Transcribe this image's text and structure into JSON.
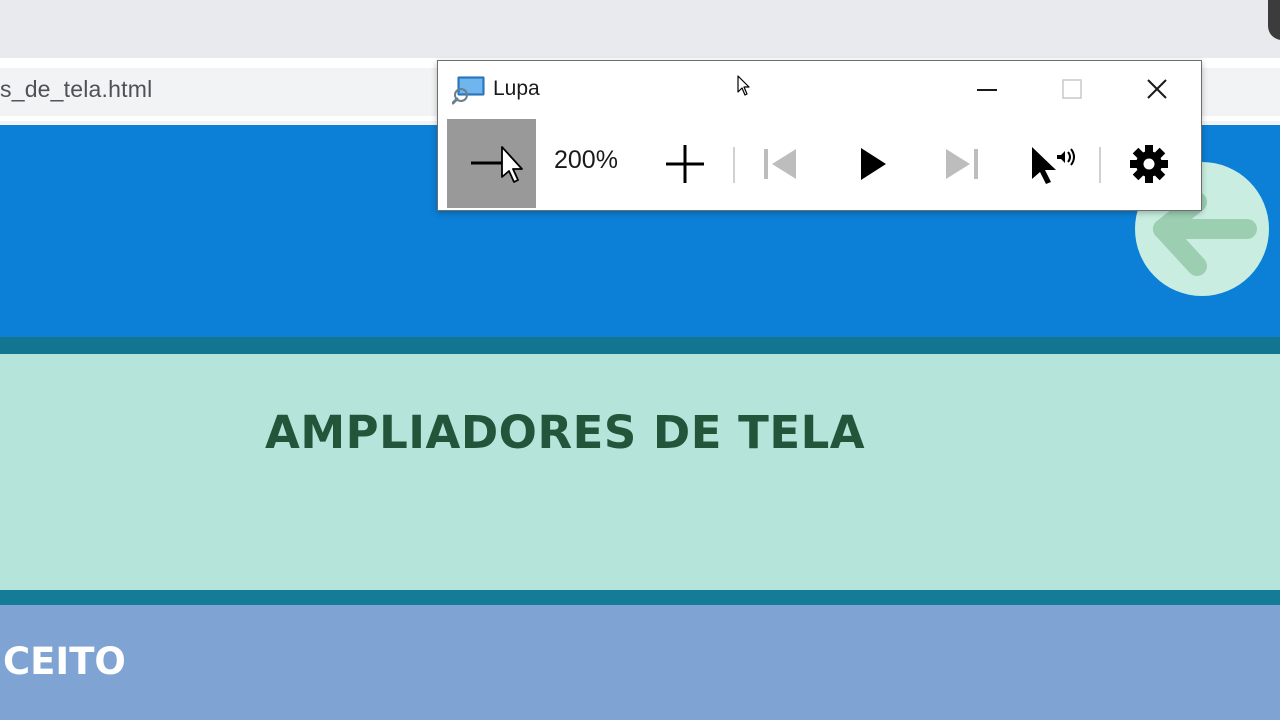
{
  "browser": {
    "url_text": "s_de_tela.html"
  },
  "page": {
    "title": "AMPLIADORES DE TELA",
    "section_title": "CEITO",
    "colors": {
      "header": "#0c7fd6",
      "divider": "#137690",
      "title_band": "#b4e4da",
      "title_text": "#22553a",
      "concept_band": "#7fa3d3"
    },
    "back_button_icon": "arrow-left-icon"
  },
  "magnifier": {
    "title": "Lupa",
    "zoom_level": "200%",
    "zoom_out_tooltip_icon": "zoom-out-icon",
    "controls": [
      "zoom-out-icon",
      "zoom-in-icon",
      "previous-icon",
      "play-icon",
      "next-icon",
      "read-from-here-icon",
      "settings-icon"
    ],
    "window_buttons": [
      "minimize-icon",
      "maximize-icon",
      "close-icon"
    ]
  }
}
